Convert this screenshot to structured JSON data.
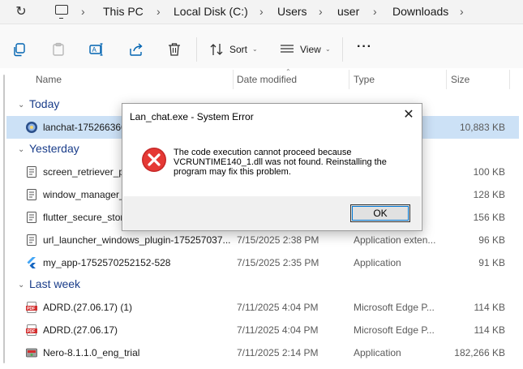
{
  "address_bar": {
    "crumbs": [
      "This PC",
      "Local Disk (C:)",
      "Users",
      "user",
      "Downloads"
    ]
  },
  "toolbar": {
    "sort_label": "Sort",
    "view_label": "View",
    "more_label": "···"
  },
  "columns": {
    "name": "Name",
    "date_modified": "Date modified",
    "type": "Type",
    "size": "Size"
  },
  "groups": {
    "today": "Today",
    "yesterday": "Yesterday",
    "last_week": "Last week"
  },
  "files": [
    {
      "name": "lanchat-1752663603",
      "date": "",
      "type": "",
      "size": "10,883 KB",
      "icon": "lanchat-app-icon"
    },
    {
      "name": "screen_retriever_plu",
      "date": "",
      "type": "",
      "size": "100 KB",
      "icon": "archive-icon"
    },
    {
      "name": "window_manager_",
      "date": "",
      "type": "",
      "size": "128 KB",
      "icon": "archive-icon"
    },
    {
      "name": "flutter_secure_stora",
      "date": "",
      "type": "",
      "size": "156 KB",
      "icon": "archive-icon"
    },
    {
      "name": "url_launcher_windows_plugin-175257037...",
      "date": "7/15/2025 2:38 PM",
      "type": "Application exten...",
      "size": "96 KB",
      "icon": "archive-icon"
    },
    {
      "name": "my_app-1752570252152-528",
      "date": "7/15/2025 2:35 PM",
      "type": "Application",
      "size": "91 KB",
      "icon": "flutter-icon"
    },
    {
      "name": "ADRD.(27.06.17) (1)",
      "date": "7/11/2025 4:04 PM",
      "type": "Microsoft Edge P...",
      "size": "114 KB",
      "icon": "pdf-icon"
    },
    {
      "name": "ADRD.(27.06.17)",
      "date": "7/11/2025 4:04 PM",
      "type": "Microsoft Edge P...",
      "size": "114 KB",
      "icon": "pdf-icon"
    },
    {
      "name": "Nero-8.1.1.0_eng_trial",
      "date": "7/11/2025 2:14 PM",
      "type": "Application",
      "size": "182,266 KB",
      "icon": "installer-icon"
    }
  ],
  "dialog": {
    "title": "Lan_chat.exe - System Error",
    "message": "The code execution cannot proceed because VCRUNTIME140_1.dll was not found. Reinstalling the program may fix this problem.",
    "ok_label": "OK",
    "icon": "error-icon"
  },
  "colors": {
    "group_heading": "#1a3d8a",
    "selection": "#cce1f6",
    "error_red": "#d32f2f"
  }
}
